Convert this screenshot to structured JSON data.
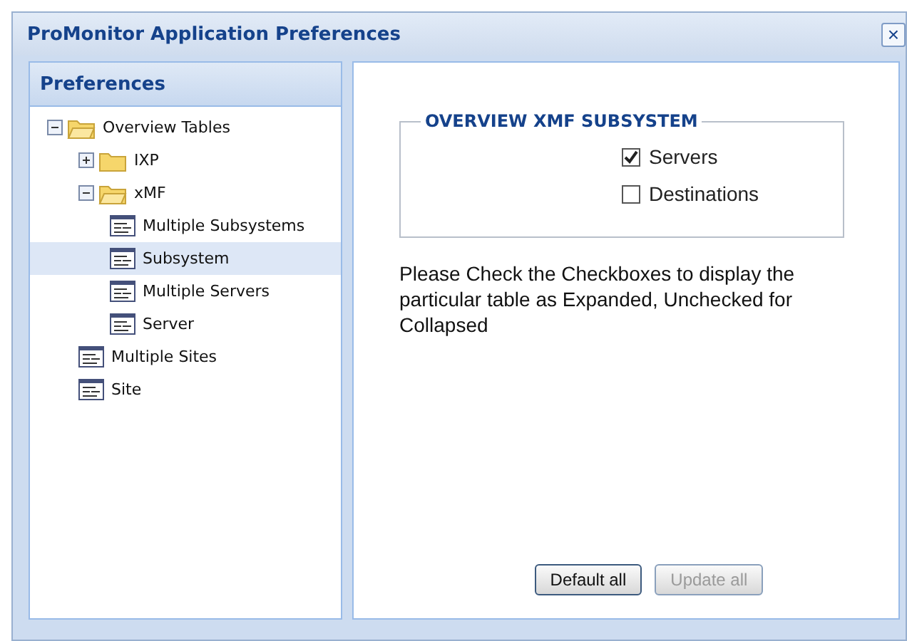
{
  "window": {
    "title": "ProMonitor Application Preferences",
    "close": "×"
  },
  "sidebar": {
    "title": "Preferences",
    "tree": [
      {
        "label": "Overview Tables",
        "kind": "folder",
        "expanded": true,
        "selected": false,
        "children": [
          {
            "label": "IXP",
            "kind": "folder",
            "expanded": false,
            "selected": false
          },
          {
            "label": "xMF",
            "kind": "folder",
            "expanded": true,
            "selected": false,
            "children": [
              {
                "label": "Multiple Subsystems",
                "kind": "leaf",
                "selected": false
              },
              {
                "label": "Subsystem",
                "kind": "leaf",
                "selected": true
              },
              {
                "label": "Multiple Servers",
                "kind": "leaf",
                "selected": false
              },
              {
                "label": "Server",
                "kind": "leaf",
                "selected": false
              }
            ]
          },
          {
            "label": "Multiple Sites",
            "kind": "leaf",
            "selected": false
          },
          {
            "label": "Site",
            "kind": "leaf",
            "selected": false
          }
        ]
      }
    ]
  },
  "group": {
    "title": "OVERVIEW XMF SUBSYSTEM",
    "options": [
      {
        "label": "Servers",
        "checked": true
      },
      {
        "label": "Destinations",
        "checked": false
      }
    ]
  },
  "note": "Please Check the Checkboxes to display the particular table as Expanded, Unchecked for Collapsed",
  "buttons": [
    {
      "label": "Default all",
      "disabled": false
    },
    {
      "label": "Update all",
      "disabled": true
    }
  ]
}
